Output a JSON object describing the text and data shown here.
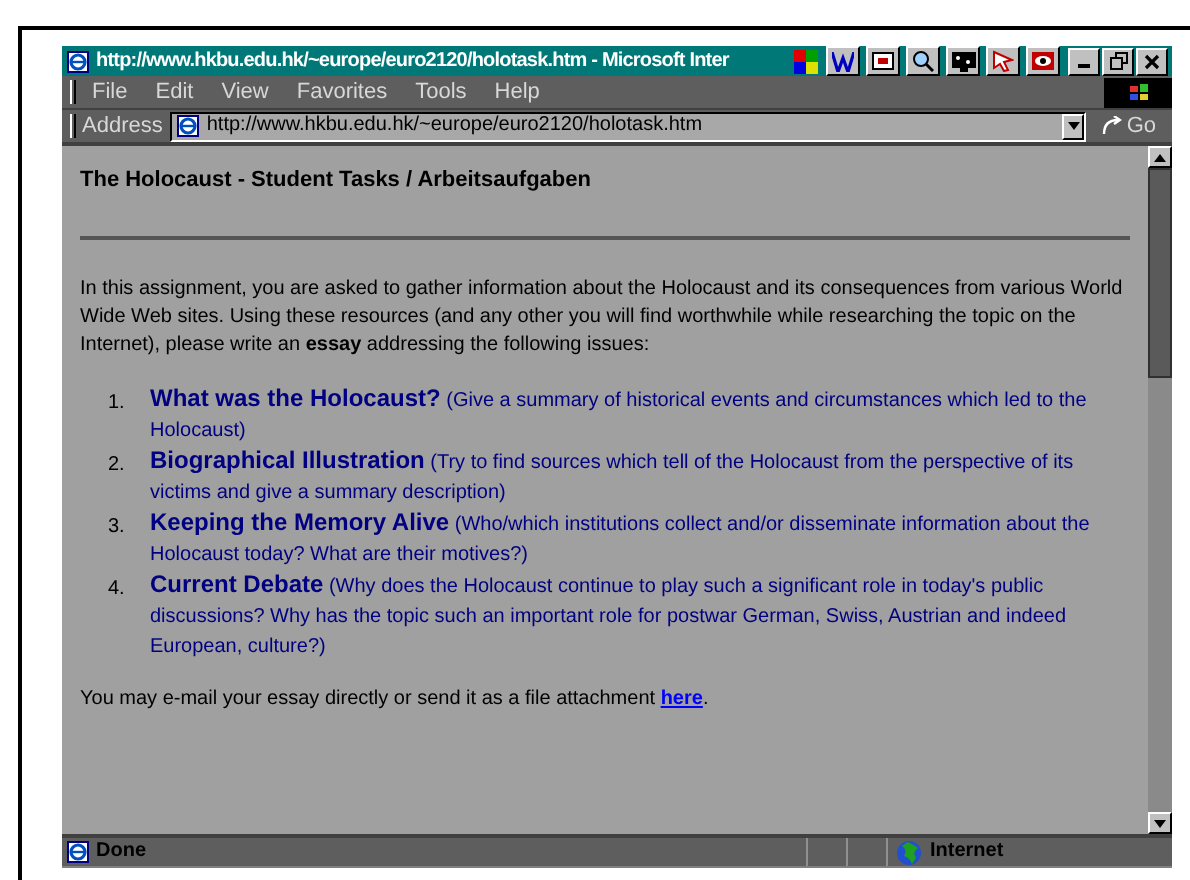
{
  "window": {
    "title": "http://www.hkbu.edu.hk/~europe/euro2120/holotask.htm - Microsoft Inter"
  },
  "menu": [
    "File",
    "Edit",
    "View",
    "Favorites",
    "Tools",
    "Help"
  ],
  "address_bar": {
    "label": "Address",
    "url": "http://www.hkbu.edu.hk/~europe/euro2120/holotask.htm",
    "go": "Go"
  },
  "page": {
    "heading": "The Holocaust - Student Tasks / Arbeitsaufgaben",
    "intro": "In this assignment, you are asked to gather information about the Holocaust and its consequences from various World Wide Web sites. Using these resources (and any other you will find worthwhile while researching the topic on the Internet), please write an **essay** addressing the following issues:",
    "issues": [
      {
        "number": "1.",
        "title": "What was the Holocaust?",
        "description": "(Give a summary of historical events and circumstances which led to the Holocaust)"
      },
      {
        "number": "2.",
        "title": "Biographical Illustration",
        "description": "(Try to find sources which tell of the Holocaust from the perspective of its victims and give a summary description)"
      },
      {
        "number": "3.",
        "title": "Keeping the Memory Alive",
        "description": "(Who/which institutions collect and/or disseminate information about the Holocaust today? What are their motives?)"
      },
      {
        "number": "4.",
        "title": "Current Debate",
        "description": "(Why does the Holocaust continue to play such a significant role in today's public discussions? Why has the topic such an important role for postwar German, Swiss, Austrian and indeed European, culture?)"
      }
    ],
    "closing": "You may e-mail your essay directly or send it as a file attachment",
    "link": "here",
    "period": "."
  },
  "status_bar": {
    "status": "Done",
    "zone": "Internet"
  }
}
